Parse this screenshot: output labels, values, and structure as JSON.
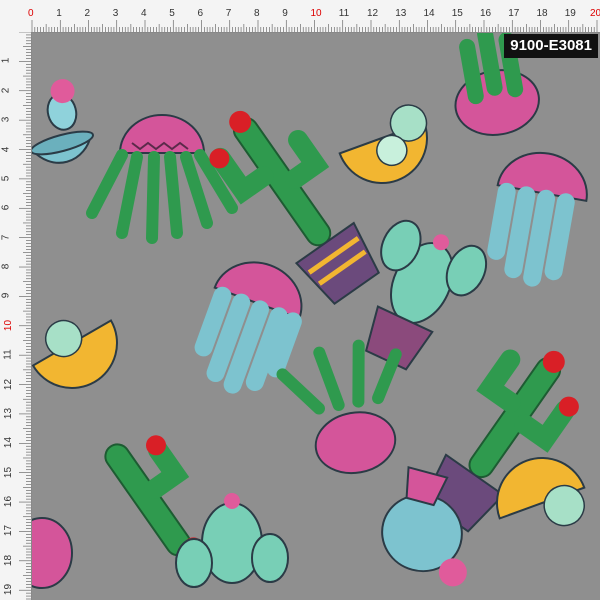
{
  "product_code": "9100-E3081",
  "ruler": {
    "top_labels": [
      "0",
      "1",
      "2",
      "3",
      "4",
      "5",
      "6",
      "7",
      "8",
      "9",
      "10",
      "11",
      "12",
      "13",
      "14",
      "15",
      "16",
      "17",
      "18",
      "19",
      "20"
    ],
    "left_labels": [
      "1",
      "2",
      "3",
      "4",
      "5",
      "6",
      "7",
      "8",
      "9",
      "10",
      "11",
      "12",
      "13",
      "14",
      "15",
      "16",
      "17",
      "18",
      "19"
    ],
    "unit": "cm"
  },
  "colors": {
    "background": "#8f8f8f",
    "cactus_green": "#2f9a4e",
    "pot_pink": "#d4559a",
    "pot_yellow": "#f2b631",
    "pot_blue": "#7dc3cf",
    "flower_red": "#d91f26",
    "succulent_mint": "#a7e0c7",
    "pot_purple": "#6b4a7c"
  }
}
